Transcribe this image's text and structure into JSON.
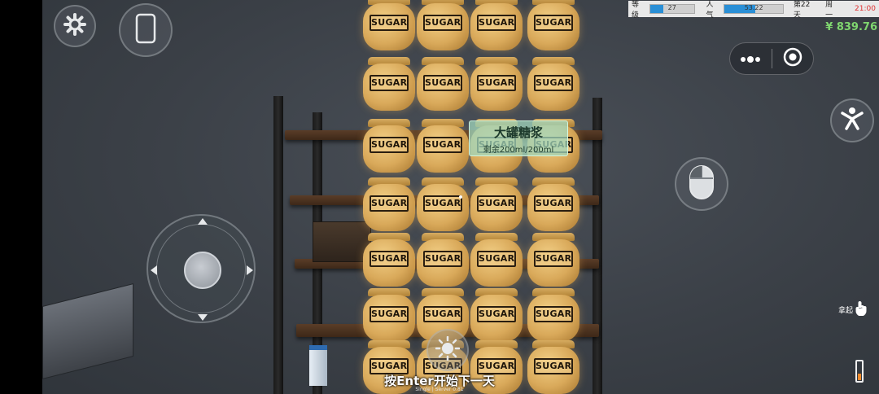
{
  "hud": {
    "level_label": "等级",
    "level_value": "27",
    "level_fill": 0.3,
    "popularity_label": "人气",
    "popularity_value": "53.22",
    "popularity_fill": 0.53,
    "day_label": "第22天",
    "weekday": "周一",
    "time": "21:00",
    "money": "¥ 839.76"
  },
  "tooltip": {
    "title": "大罐糖浆",
    "remaining": "剩余200ml/200ml"
  },
  "hint": "按Enter开始下一天",
  "version": "Single | Server 0.81",
  "pickup_label": "拿起",
  "jar_label": "SUGAR",
  "colors": {
    "money": "#7fd66f",
    "time": "#e03030",
    "bar_fill": "#2a8fd6"
  },
  "icons": [
    "gear-icon",
    "phone-icon",
    "more-dots-icon",
    "target-icon",
    "jump-icon",
    "mouse-icon",
    "sun-icon",
    "hand-icon",
    "battery-icon"
  ]
}
